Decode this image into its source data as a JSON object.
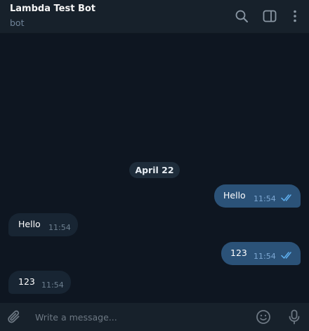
{
  "header": {
    "title": "Lambda Test Bot",
    "subtitle": "bot",
    "icons": [
      "search-icon",
      "sidebar-toggle-icon",
      "more-vertical-icon"
    ]
  },
  "messages": {
    "date": "April 22",
    "items": [
      {
        "direction": "out",
        "text": "Hello",
        "time": "11:54",
        "read": true
      },
      {
        "direction": "in",
        "text": "Hello",
        "time": "11:54"
      },
      {
        "direction": "out",
        "text": "123",
        "time": "11:54",
        "read": true
      },
      {
        "direction": "in",
        "text": "123",
        "time": "11:54"
      }
    ]
  },
  "composer": {
    "placeholder": "Write a message...",
    "icons": [
      "paperclip-icon",
      "emoji-icon",
      "microphone-icon"
    ]
  },
  "colors": {
    "background": "#0e1621",
    "header": "#17212b",
    "outgoing_bubble": "#2b5278",
    "incoming_bubble": "#182533",
    "read_check": "#5fb0f0"
  }
}
